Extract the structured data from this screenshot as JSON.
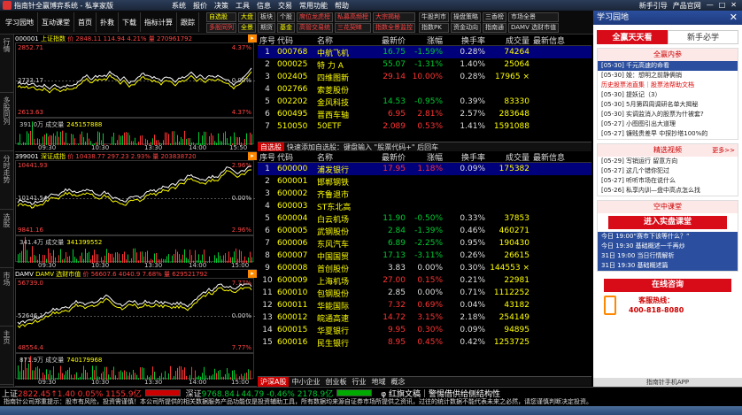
{
  "window": {
    "title": "指南针全赢博弈系统 - 私享家版",
    "menu": [
      "系统",
      "报价",
      "决策",
      "工具",
      "信息",
      "交易",
      "常用功能",
      "帮助"
    ],
    "right": [
      "新手引导",
      "产品官网"
    ]
  },
  "toolbar": {
    "left": [
      "学习园地",
      "互动课堂",
      "首页",
      "扑救",
      "下载",
      "指标计算",
      "跟踪"
    ],
    "grid": [
      "自选股",
      "大盘",
      "板块",
      "个股",
      "席位龙虎榜",
      "私募高频榜",
      "大宗揭秘",
      "牛股判市",
      "操盘策略",
      "三香榜",
      "市场全景",
      "多股同列",
      "全景",
      "期货",
      "基金",
      "高管交易统",
      "三花契睐",
      "指数全景监控",
      "指数PK",
      "资金动向",
      "指南通",
      "DAMV 选财市值"
    ]
  },
  "leftnav": [
    "行情",
    "多股同列",
    "分时走势",
    "选股",
    "市场",
    "主页"
  ],
  "charts": [
    {
      "name": "上证指数",
      "code": "000001",
      "hdr": "价 2848.11 114.94 4.21% 量 270961792",
      "lmax": "2852.71",
      "lmid": "2733.17",
      "lmin": "2613.63",
      "rmax": "4.37%",
      "rmid": "0.00%",
      "rmin": "4.37%",
      "vol_label": "成交量",
      "vol": "245157888",
      "vlow": "391.0万",
      "unit": "万",
      "times": [
        "09:30",
        "10:30",
        "13:30",
        "14:00",
        "15:50"
      ]
    },
    {
      "name": "深证成指",
      "code": "399001",
      "hdr": "价 10438.77 297.23 2.93% 量 203838720",
      "lmax": "10441.93",
      "lmid": "10141.54",
      "lmin": "9841.16",
      "rmax": "2.96%",
      "rmid": "0.00%",
      "rmin": "2.96%",
      "vol_label": "成交量",
      "vol": "341399552",
      "vlow": "341.4万",
      "unit": "万",
      "times": [
        "09:30",
        "10:30",
        "13:30",
        "14:00",
        "15:00"
      ]
    },
    {
      "name": "DAMV 选财市值",
      "code": "DAMV",
      "hdr": "价 56607.6 4040.9 7.68% 量 629521792",
      "lmax": "56739.0",
      "lmid": "52646.1",
      "lmin": "48554.4",
      "rmax": "7.77%",
      "rmid": "0.00%",
      "rmin": "7.77%",
      "vol_label": "成交量",
      "vol": "740179968",
      "vlow": "871.9万",
      "unit": "万",
      "times": [
        "09:30",
        "10:30",
        "13:30",
        "14:00",
        "15:00"
      ]
    }
  ],
  "table_headers": [
    "序号",
    "代码",
    "名称",
    "最新价",
    "涨幅",
    "换手率",
    "成交量",
    "最新信息"
  ],
  "table1": [
    {
      "n": "1",
      "code": "000768",
      "name": "中航飞机",
      "price": "16.75",
      "chg": "-1.59%",
      "turn": "0.28%",
      "vol": "74264",
      "d": "dn"
    },
    {
      "n": "2",
      "code": "000025",
      "name": "特 力 A",
      "price": "55.07",
      "chg": "-1.31%",
      "turn": "1.40%",
      "vol": "25064",
      "d": "dn"
    },
    {
      "n": "3",
      "code": "002405",
      "name": "四维图新",
      "price": "29.14",
      "chg": "10.00%",
      "turn": "0.28%",
      "vol": "17965 ×",
      "d": "up"
    },
    {
      "n": "4",
      "code": "002766",
      "name": "索菱股份",
      "price": "",
      "chg": "",
      "turn": "",
      "vol": "",
      "d": "eq"
    },
    {
      "n": "5",
      "code": "002202",
      "name": "金风科技",
      "price": "14.53",
      "chg": "-0.95%",
      "turn": "0.39%",
      "vol": "83330",
      "d": "dn"
    },
    {
      "n": "6",
      "code": "600495",
      "name": "晋西车轴",
      "price": "6.95",
      "chg": "2.81%",
      "turn": "2.57%",
      "vol": "283648",
      "d": "up"
    },
    {
      "n": "7",
      "code": "510050",
      "name": "50ETF",
      "price": "2.089",
      "chg": "0.53%",
      "turn": "1.41%",
      "vol": "1591088",
      "d": "up"
    }
  ],
  "tab1": {
    "active": "自选股",
    "hint": "快速添加自选股：键盘输入 \"股票代码+\" 后回车"
  },
  "table2": [
    {
      "n": "1",
      "code": "600000",
      "name": "浦发银行",
      "price": "17.95",
      "chg": "1.18%",
      "turn": "0.09%",
      "vol": "175382",
      "d": "up"
    },
    {
      "n": "2",
      "code": "600001",
      "name": "邯郸钢铁",
      "price": "",
      "chg": "",
      "turn": "",
      "vol": "",
      "d": "eq"
    },
    {
      "n": "3",
      "code": "600002",
      "name": "齐鲁退市",
      "price": "",
      "chg": "",
      "turn": "",
      "vol": "",
      "d": "eq"
    },
    {
      "n": "4",
      "code": "600003",
      "name": "ST东北高",
      "price": "",
      "chg": "",
      "turn": "",
      "vol": "",
      "d": "eq"
    },
    {
      "n": "5",
      "code": "600004",
      "name": "白云机场",
      "price": "11.90",
      "chg": "-0.50%",
      "turn": "0.33%",
      "vol": "37853",
      "d": "dn"
    },
    {
      "n": "6",
      "code": "600005",
      "name": "武钢股份",
      "price": "2.84",
      "chg": "-1.39%",
      "turn": "0.46%",
      "vol": "460271",
      "d": "dn"
    },
    {
      "n": "7",
      "code": "600006",
      "name": "东风汽车",
      "price": "6.89",
      "chg": "-2.25%",
      "turn": "0.95%",
      "vol": "190430",
      "d": "dn"
    },
    {
      "n": "8",
      "code": "600007",
      "name": "中国国贸",
      "price": "17.13",
      "chg": "-3.11%",
      "turn": "0.26%",
      "vol": "26615",
      "d": "dn"
    },
    {
      "n": "9",
      "code": "600008",
      "name": "首创股份",
      "price": "3.83",
      "chg": "0.00%",
      "turn": "0.30%",
      "vol": "144553 ×",
      "d": "eq"
    },
    {
      "n": "10",
      "code": "600009",
      "name": "上海机场",
      "price": "27.00",
      "chg": "0.15%",
      "turn": "0.21%",
      "vol": "22981",
      "d": "up"
    },
    {
      "n": "11",
      "code": "600010",
      "name": "包钢股份",
      "price": "2.85",
      "chg": "0.00%",
      "turn": "0.71%",
      "vol": "1112252",
      "d": "eq"
    },
    {
      "n": "12",
      "code": "600011",
      "name": "华能国际",
      "price": "7.32",
      "chg": "0.69%",
      "turn": "0.04%",
      "vol": "43182",
      "d": "up"
    },
    {
      "n": "13",
      "code": "600012",
      "name": "皖通高速",
      "price": "14.72",
      "chg": "3.15%",
      "turn": "2.18%",
      "vol": "254149",
      "d": "up"
    },
    {
      "n": "14",
      "code": "600015",
      "name": "华夏银行",
      "price": "9.95",
      "chg": "0.30%",
      "turn": "0.09%",
      "vol": "94895",
      "d": "up"
    },
    {
      "n": "15",
      "code": "600016",
      "name": "民生银行",
      "price": "8.95",
      "chg": "0.45%",
      "turn": "0.42%",
      "vol": "1253725",
      "d": "up"
    }
  ],
  "tab2": [
    "沪深A股",
    "中小企业",
    "创业板",
    "行业",
    "地域",
    "概念"
  ],
  "right": {
    "title": "学习园地",
    "tabs": [
      "全赢天天看",
      "新手必学"
    ],
    "sec1": "全赢内参",
    "items1": [
      "[05-30] 千元高速的命看",
      "[05-30] 娩：想明之前静俩销",
      "历史股票池直集｜股票池帮助文档",
      "[05-30] 提妖记（3）",
      "[05-30] 5月第四周调研名单大揭秘",
      "[05-30] 实调监消入的股票为什被套?",
      "[05-27] 小图图引出大道理",
      "[05-27] 镰贱贵差早 中探抄塔100%的"
    ],
    "sec2": "精选视频",
    "more": "更多>>",
    "items2": [
      "[05-29] 写销运行 留意方向",
      "[05-27] 这几个错你犯过",
      "[05-27] 听听市场在说什么",
      "[05-26] 私享内训—盘中高点怎么找"
    ],
    "sec3": "空中课堂",
    "btn1": "进入实盘课堂",
    "items3": [
      "今日 19:00“赛市下该等什么？”",
      "今日 19:30 基础概述一千再炒",
      "31日 19:00 当日行情解析",
      "31日 19:30 基础概述篇"
    ],
    "btn2": "在线咨询",
    "hotline_label": "客服热线：",
    "hotline": "400-818-8080",
    "foot": "指南针手机APP"
  },
  "status": {
    "sh_label": "上证",
    "sh": "2822.45↑1.40 0.05% 1155.9亿",
    "sz_label": "深证",
    "sz": "9768.84↓44.79 -0.46% 2178.9亿",
    "ticker": "φ 红旗文稿｜警惕借供给侧结构性"
  },
  "notice": "指南针公司郑重提示：股市有风险，投资需谨慎！本公司所提供的相关数据服务产品功能仅是投资辅助工具，所有数据均来源自证券市场所提供之资讯，过往的统计数据不能代表未来之必然，请您谨慎判断决定投资。"
}
